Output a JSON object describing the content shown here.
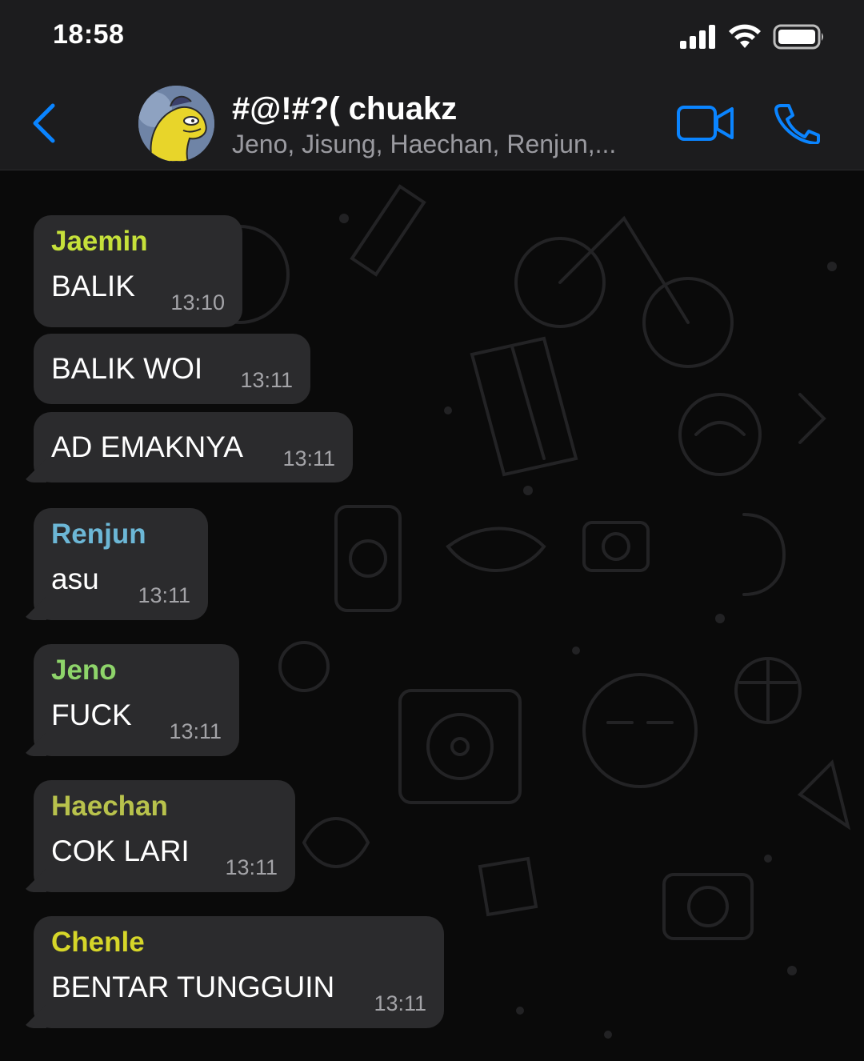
{
  "status": {
    "time": "18:58"
  },
  "header": {
    "title": "#@!#?( chuakz",
    "members": "Jeno, Jisung, Haechan, Renjun,..."
  },
  "colors": {
    "accent": "#0a84ff",
    "bubble": "#2b2b2d",
    "jaemin": "#c6e13a",
    "renjun": "#6cb7d6",
    "jeno": "#8ed46a",
    "haechan": "#b8c24c",
    "chenle": "#d6d629"
  },
  "messages": [
    {
      "sender": "Jaemin",
      "text": "BALIK",
      "time": "13:10"
    },
    {
      "sender": "",
      "text": "BALIK WOI",
      "time": "13:11"
    },
    {
      "sender": "",
      "text": "AD EMAKNYA",
      "time": "13:11"
    },
    {
      "sender": "Renjun",
      "text": "asu",
      "time": "13:11"
    },
    {
      "sender": "Jeno",
      "text": "FUCK",
      "time": "13:11"
    },
    {
      "sender": "Haechan",
      "text": "COK LARI",
      "time": "13:11"
    },
    {
      "sender": "Chenle",
      "text": "BENTAR TUNGGUIN",
      "time": "13:11"
    }
  ]
}
